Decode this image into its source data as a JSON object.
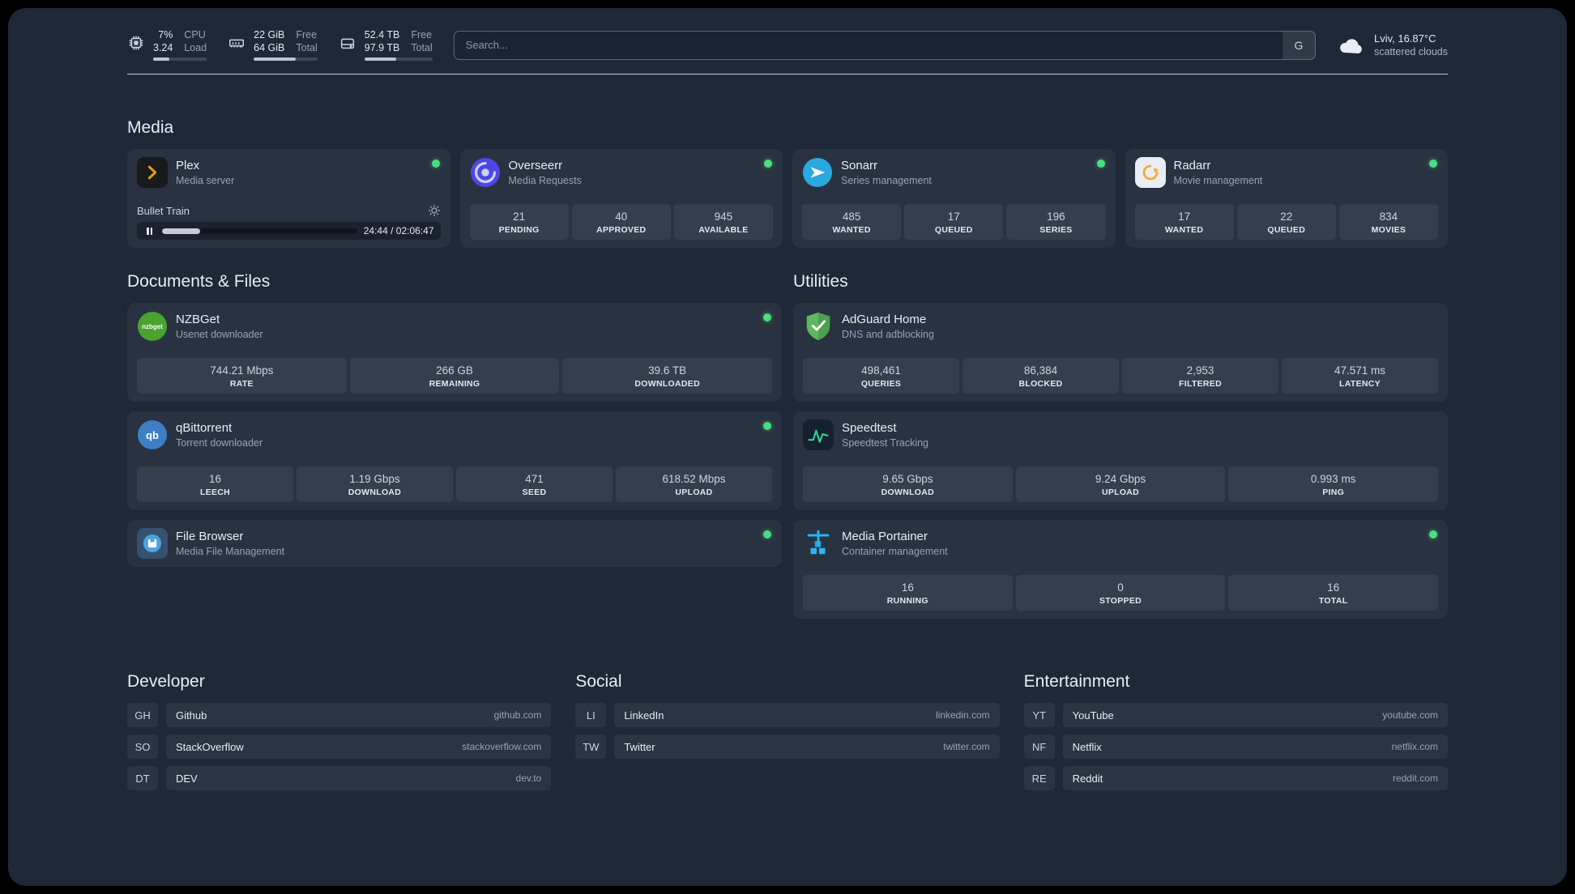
{
  "colors": {
    "online_dot": "#4ade80",
    "plex_amber": "#e5a00d",
    "overseerr_purple": "#4f46e5",
    "sonarr_blue": "#2aa8e0",
    "radarr_amber": "#f5a623",
    "nzbget_green": "#4aa32f",
    "qbittorrent_blue": "#3d7fc4",
    "adguard_green": "#5fb760",
    "speedtest_green": "#34d399",
    "portainer_blue": "#29b6f6"
  },
  "topbar": {
    "cpu": {
      "value_top": "7%",
      "value_bottom": "3.24",
      "label_top": "CPU",
      "label_bottom": "Load",
      "bar_percent": 30
    },
    "memory": {
      "value_top": "22 GiB",
      "value_bottom": "64 GiB",
      "label_top": "Free",
      "label_bottom": "Total",
      "bar_percent": 66
    },
    "disk": {
      "value_top": "52.4 TB",
      "value_bottom": "97.9 TB",
      "label_top": "Free",
      "label_bottom": "Total",
      "bar_percent": 47
    },
    "search": {
      "placeholder": "Search...",
      "provider_label": "G"
    },
    "weather": {
      "location": "Lviv, 16.87°C",
      "condition": "scattered clouds"
    }
  },
  "media": {
    "title": "Media",
    "plex": {
      "name": "Plex",
      "desc": "Media server",
      "player_title": "Bullet Train",
      "player_time": "24:44 / 02:06:47",
      "progress_percent": 19.5
    },
    "overseerr": {
      "name": "Overseerr",
      "desc": "Media Requests",
      "stats": [
        {
          "value": "21",
          "label": "PENDING"
        },
        {
          "value": "40",
          "label": "APPROVED"
        },
        {
          "value": "945",
          "label": "AVAILABLE"
        }
      ]
    },
    "sonarr": {
      "name": "Sonarr",
      "desc": "Series management",
      "stats": [
        {
          "value": "485",
          "label": "WANTED"
        },
        {
          "value": "17",
          "label": "QUEUED"
        },
        {
          "value": "196",
          "label": "SERIES"
        }
      ]
    },
    "radarr": {
      "name": "Radarr",
      "desc": "Movie management",
      "stats": [
        {
          "value": "17",
          "label": "WANTED"
        },
        {
          "value": "22",
          "label": "QUEUED"
        },
        {
          "value": "834",
          "label": "MOVIES"
        }
      ]
    }
  },
  "documents": {
    "title": "Documents & Files",
    "nzbget": {
      "name": "NZBGet",
      "desc": "Usenet downloader",
      "icon_text": "nzbget",
      "stats": [
        {
          "value": "744.21 Mbps",
          "label": "RATE"
        },
        {
          "value": "266 GB",
          "label": "REMAINING"
        },
        {
          "value": "39.6 TB",
          "label": "DOWNLOADED"
        }
      ]
    },
    "qbittorrent": {
      "name": "qBittorrent",
      "desc": "Torrent downloader",
      "icon_text": "qb",
      "stats": [
        {
          "value": "16",
          "label": "LEECH"
        },
        {
          "value": "1.19 Gbps",
          "label": "DOWNLOAD"
        },
        {
          "value": "471",
          "label": "SEED"
        },
        {
          "value": "618.52 Mbps",
          "label": "UPLOAD"
        }
      ]
    },
    "filebrowser": {
      "name": "File Browser",
      "desc": "Media File Management"
    }
  },
  "utilities": {
    "title": "Utilities",
    "adguard": {
      "name": "AdGuard Home",
      "desc": "DNS and adblocking",
      "stats": [
        {
          "value": "498,461",
          "label": "QUERIES"
        },
        {
          "value": "86,384",
          "label": "BLOCKED"
        },
        {
          "value": "2,953",
          "label": "FILTERED"
        },
        {
          "value": "47.571 ms",
          "label": "LATENCY"
        }
      ]
    },
    "speedtest": {
      "name": "Speedtest",
      "desc": "Speedtest Tracking",
      "stats": [
        {
          "value": "9.65 Gbps",
          "label": "DOWNLOAD"
        },
        {
          "value": "9.24 Gbps",
          "label": "UPLOAD"
        },
        {
          "value": "0.993 ms",
          "label": "PING"
        }
      ]
    },
    "portainer": {
      "name": "Media Portainer",
      "desc": "Container management",
      "stats": [
        {
          "value": "16",
          "label": "RUNNING"
        },
        {
          "value": "0",
          "label": "STOPPED"
        },
        {
          "value": "16",
          "label": "TOTAL"
        }
      ]
    }
  },
  "bookmarks": {
    "developer": {
      "title": "Developer",
      "items": [
        {
          "abbr": "GH",
          "name": "Github",
          "url": "github.com"
        },
        {
          "abbr": "SO",
          "name": "StackOverflow",
          "url": "stackoverflow.com"
        },
        {
          "abbr": "DT",
          "name": "DEV",
          "url": "dev.to"
        }
      ]
    },
    "social": {
      "title": "Social",
      "items": [
        {
          "abbr": "LI",
          "name": "LinkedIn",
          "url": "linkedin.com"
        },
        {
          "abbr": "TW",
          "name": "Twitter",
          "url": "twitter.com"
        }
      ]
    },
    "entertainment": {
      "title": "Entertainment",
      "items": [
        {
          "abbr": "YT",
          "name": "YouTube",
          "url": "youtube.com"
        },
        {
          "abbr": "NF",
          "name": "Netflix",
          "url": "netflix.com"
        },
        {
          "abbr": "RE",
          "name": "Reddit",
          "url": "reddit.com"
        }
      ]
    }
  }
}
